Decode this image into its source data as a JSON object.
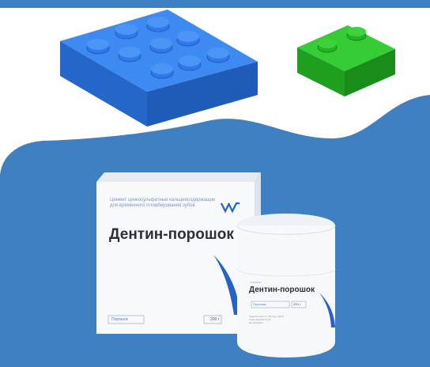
{
  "colors": {
    "top_bar": "#3e7fc0",
    "background_panel": "#3f80c2",
    "blue_brick": "#2f78e6",
    "green_brick": "#23b823",
    "product_accent": "#2563c8"
  },
  "box": {
    "description": "Цемент цинкосульфатный кальцийсодержащий для временного пломбирования зубов",
    "title": "Дентин-порошок",
    "field_label": "Порошок",
    "weight": "200 г",
    "logo_icon": "vv-logo-icon"
  },
  "jar": {
    "brand": "VLADMIVA",
    "title": "Дентин-порошок",
    "field_label": "Порошок",
    "weight": "200 г",
    "small_text": "Хранить при t от +5°С до +25°С\nСрок годности 5 лет\nНе подлежит ..."
  },
  "decor": {
    "blue_brick_icon": "blue-lego-brick-icon",
    "green_brick_icon": "green-lego-brick-icon"
  }
}
